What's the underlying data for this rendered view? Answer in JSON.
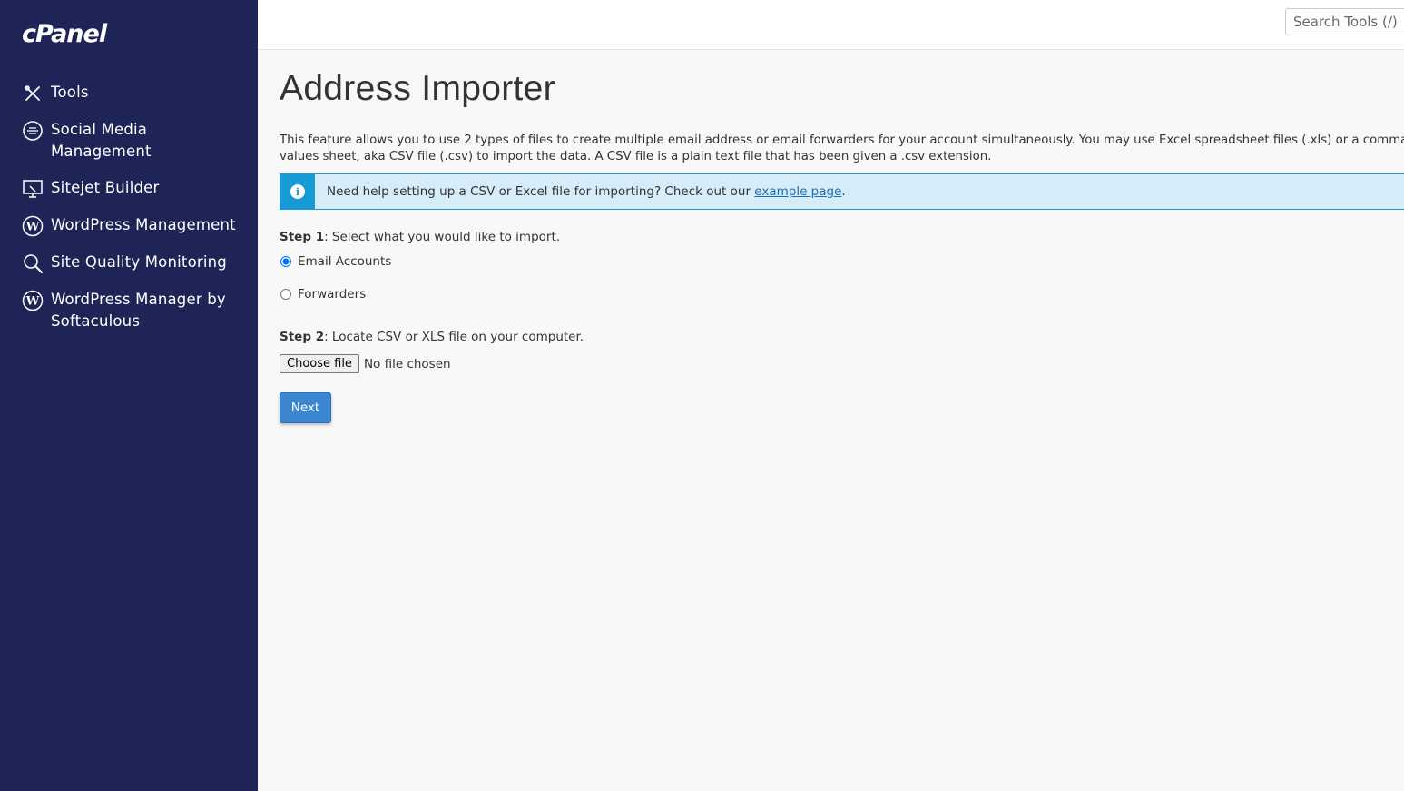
{
  "brand": {
    "logo_text": "cPanel"
  },
  "sidebar": {
    "items": [
      {
        "label": "Tools",
        "icon": "tools-icon"
      },
      {
        "label": "Social Media\nManagement",
        "icon": "social-media-icon"
      },
      {
        "label": "Sitejet Builder",
        "icon": "sitejet-icon"
      },
      {
        "label": "WordPress Management",
        "icon": "wordpress-icon"
      },
      {
        "label": "Site Quality Monitoring",
        "icon": "magnifier-icon"
      },
      {
        "label": "WordPress Manager by\nSoftaculous",
        "icon": "wordpress-icon"
      }
    ]
  },
  "search": {
    "placeholder": "Search Tools (/)"
  },
  "page": {
    "title": "Address Importer",
    "description_line1": "This feature allows you to use 2 types of files to create multiple email address or email forwarders for your account simultaneously. You may use Excel spreadsheet files (.xls) or a comma-separated",
    "description_line2": "values sheet, aka CSV file (.csv) to import the data. A CSV file is a plain text file that has been given a .csv extension."
  },
  "info": {
    "text_before": "Need help setting up a CSV or Excel file for importing? Check out our ",
    "link_text": "example page",
    "text_after": "."
  },
  "step1": {
    "label": "Step 1",
    "text": ": Select what you would like to import.",
    "options": [
      {
        "label": "Email Accounts",
        "selected": true
      },
      {
        "label": "Forwarders",
        "selected": false
      }
    ]
  },
  "step2": {
    "label": "Step 2",
    "text": ": Locate CSV or XLS file on your computer.",
    "file_button": "Choose file",
    "file_status": "No file chosen"
  },
  "next_button": "Next",
  "colors": {
    "sidebar_bg": "#1f2456",
    "info_bg": "#d6ecf8",
    "info_accent": "#179bd7",
    "primary_button": "#3a86d0"
  }
}
